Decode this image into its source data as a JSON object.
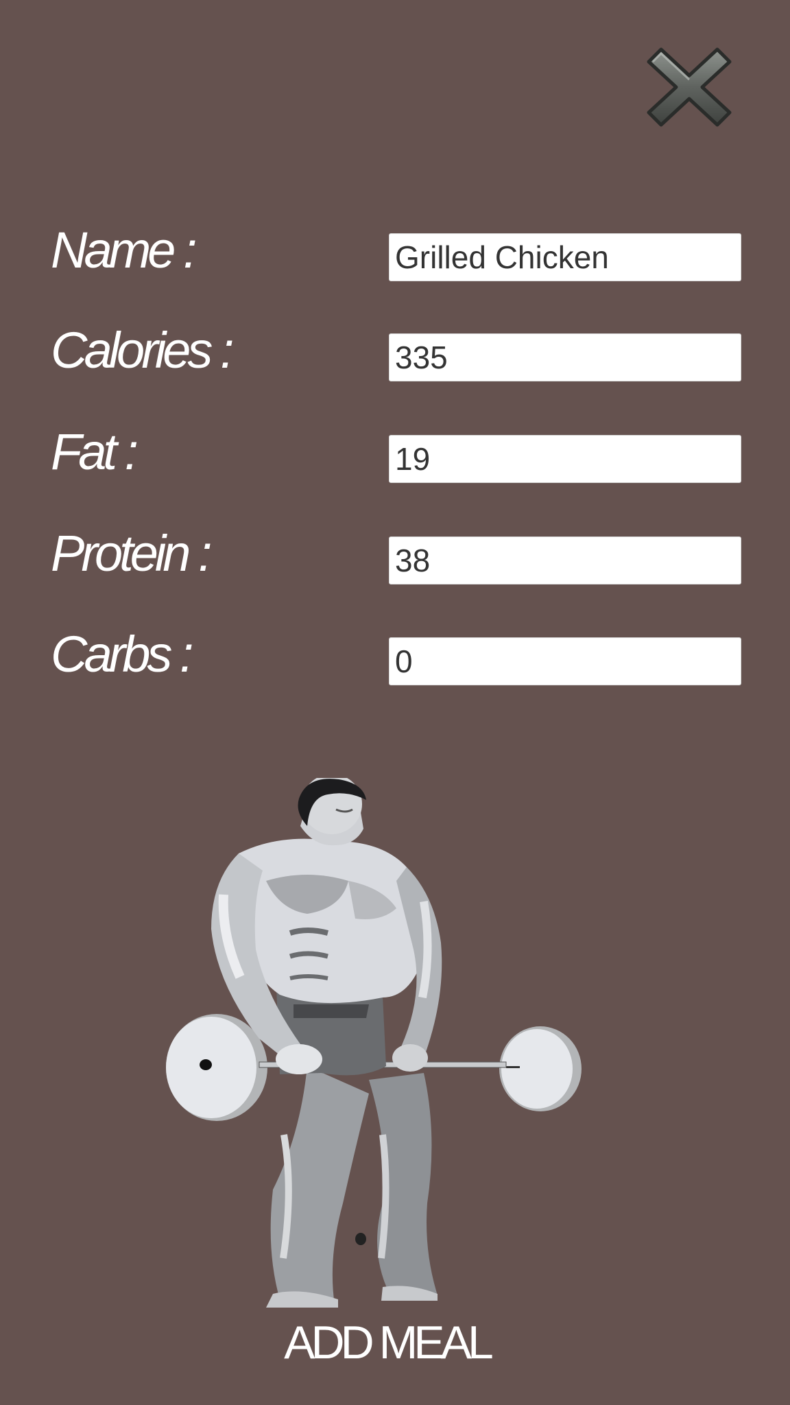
{
  "close": {
    "icon": "close-icon"
  },
  "form": {
    "name": {
      "label": "Name :",
      "value": "Grilled Chicken"
    },
    "calories": {
      "label": "Calories :",
      "value": "335"
    },
    "fat": {
      "label": "Fat :",
      "value": "19"
    },
    "protein": {
      "label": "Protein :",
      "value": "38"
    },
    "carbs": {
      "label": "Carbs :",
      "value": "0"
    }
  },
  "illustration": {
    "icon": "bodybuilder-illustration"
  },
  "actions": {
    "add_meal_label": "ADD MEAL"
  },
  "colors": {
    "background": "#65524f",
    "label_text": "#ffffff",
    "input_background": "#ffffff",
    "input_text": "#333333"
  }
}
